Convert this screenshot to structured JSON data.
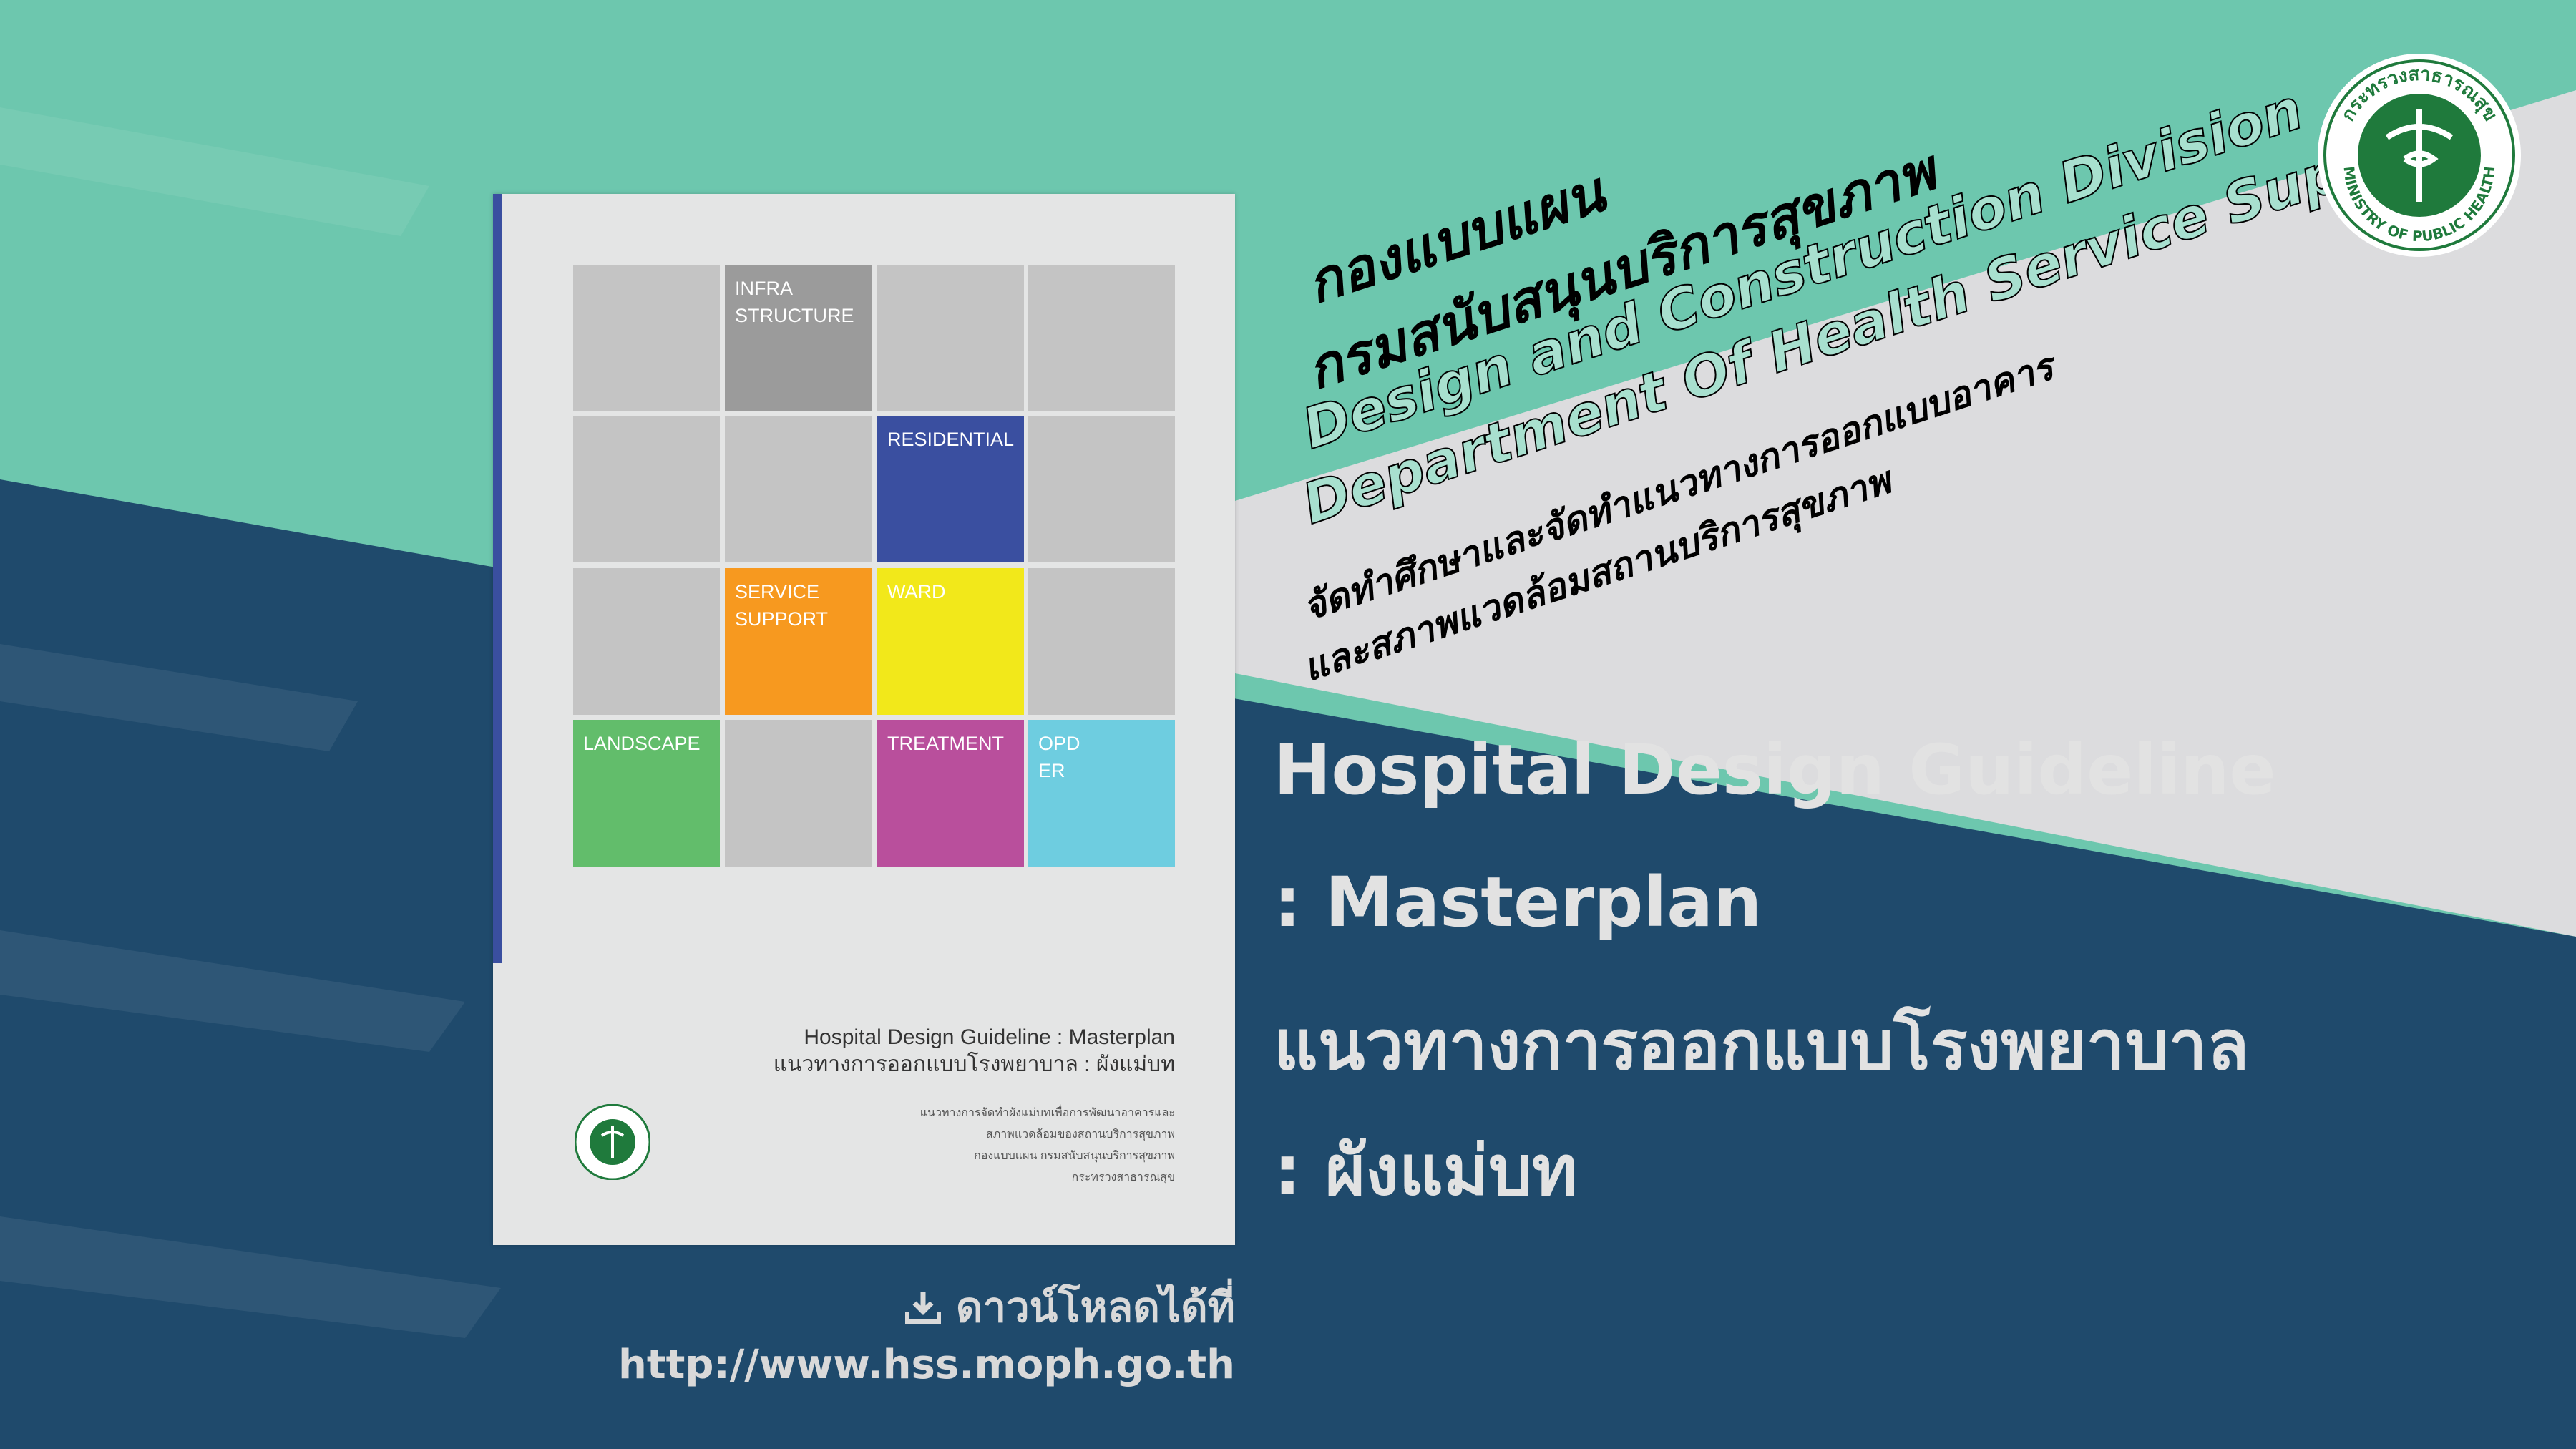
{
  "colors": {
    "teal": "#6dc7ae",
    "grey_band": "#dcdcde",
    "navy": "#1f4a6c",
    "book": "#e4e5e5"
  },
  "header": {
    "thai_line1": "กองแบบแผน",
    "thai_line2": "กรมสนับสนุนบริการสุขภาพ",
    "en_line1": "Design and Construction Division",
    "en_line2": "Department Of Health Service Support",
    "mission_line1": "จัดทำศึกษาและจัดทำแนวทางการออกแบบอาคาร",
    "mission_line2": "และสภาพแวดล้อมสถานบริการสุขภาพ"
  },
  "logo": {
    "text_top": "กระทรวงสาธารณสุข",
    "text_bottom": "MINISTRY OF PUBLIC HEALTH",
    "icon": "caduceus-emblem"
  },
  "headline": {
    "line1": "Hospital Design Guideline",
    "line2": ": Masterplan",
    "line3": "แนวทางการออกแบบโรงพยาบาล",
    "line4": ": ผังแม่บท"
  },
  "book": {
    "cells": [
      {
        "label": "",
        "color": "#c4c4c4"
      },
      {
        "label": "INFRA\nSTRUCTURE",
        "color": "#9b9b9b"
      },
      {
        "label": "",
        "color": "#c4c4c4"
      },
      {
        "label": "",
        "color": "#c4c4c4"
      },
      {
        "label": "",
        "color": "#c4c4c4"
      },
      {
        "label": "",
        "color": "#c4c4c4"
      },
      {
        "label": "RESIDENTIAL",
        "color": "#3a4fa0"
      },
      {
        "label": "",
        "color": "#c4c4c4"
      },
      {
        "label": "",
        "color": "#c4c4c4"
      },
      {
        "label": "SERVICE\nSUPPORT",
        "color": "#f7991f"
      },
      {
        "label": "WARD",
        "color": "#f2e81a"
      },
      {
        "label": "",
        "color": "#c4c4c4"
      },
      {
        "label": "LANDSCAPE",
        "color": "#62bd6b"
      },
      {
        "label": "",
        "color": "#c4c4c4"
      },
      {
        "label": "TREATMENT",
        "color": "#b94f9c"
      },
      {
        "label": "OPD\nER",
        "color": "#6ecde0"
      }
    ],
    "title_en": "Hospital Design Guideline : Masterplan",
    "title_th": "แนวทางการออกแบบโรงพยาบาล : ผังแม่บท",
    "sub": [
      "แนวทางการจัดทำผังแม่บทเพื่อการพัฒนาอาคารและ",
      "สภาพแวดล้อมของสถานบริการสุขภาพ",
      "กองแบบแผน กรมสนับสนุนบริการสุขภาพ",
      "กระทรวงสาธารณสุข"
    ]
  },
  "download": {
    "label": "ดาวน์โหลดได้ที่",
    "url": "http://www.hss.moph.go.th",
    "icon": "download-icon"
  }
}
